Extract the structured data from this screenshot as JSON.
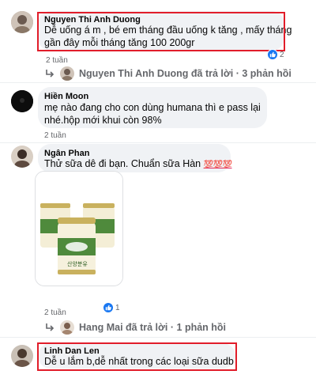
{
  "comments": [
    {
      "author": "Nguyen Thi Anh Duong",
      "text_line1": "Dễ uống á m , bé em tháng đầu uống k tăng , mấy tháng",
      "text_line2": "gần đây mỗi tháng tăng 100 200gr",
      "time": "2 tuần",
      "reaction_count": "2",
      "reply_author": "Nguyen Thi Anh Duong",
      "reply_action": "đã trả lời",
      "reply_count": "· 3 phản hồi"
    },
    {
      "author": "Hiền Moon",
      "text_line1": "mẹ nào đang cho con dùng humana thì e pass lại",
      "text_line2": "nhé.hộp mới khui còn 98%",
      "time": "2 tuần"
    },
    {
      "author": "Ngân Phan",
      "text_line1": "Thử sữa dê đi bạn. Chuẩn sữa Hàn",
      "emoji": "💯💯💯",
      "time": "2 tuần",
      "reaction_count": "1",
      "reply_author": "Hang Mai",
      "reply_action": "đã trả lời",
      "reply_count": "· 1 phản hồi",
      "product_label": "산양분유"
    },
    {
      "author": "Linh Dan Len",
      "text_line1": "Dễ u lắm b,dễ nhất trong các loại sữa dudb"
    }
  ],
  "colors": {
    "highlight": "#e11d2a",
    "bubble": "#f0f2f5",
    "like_blue": "#1877f2",
    "muted": "#65676b"
  },
  "icons": [
    "reply-arrow-icon",
    "like-icon",
    "avatar-icon"
  ]
}
